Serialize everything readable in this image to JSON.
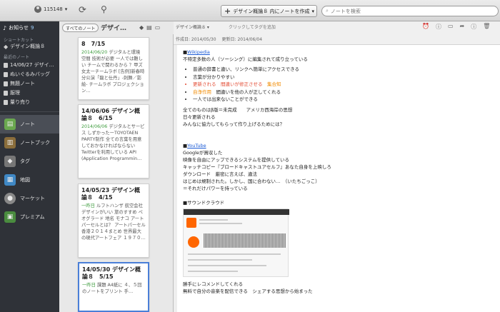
{
  "toolbar": {
    "username": "115148",
    "new_note_label": "デザイン概論８ 内にノートを作成",
    "search_placeholder": "ノートを検索"
  },
  "sidebar": {
    "notice_label": "お知らせ",
    "notice_count": "9",
    "shortcut_heading": "ショートカット",
    "shortcut_items": [
      "デザイン概論８"
    ],
    "recent_heading": "最近のノート",
    "recent_items": [
      "14/06/27 デザイ…",
      "ぬいぐるみバッグ",
      "無題ノート",
      "服理",
      "量り売り"
    ],
    "nav": [
      {
        "label": "ノート",
        "icon": "note-icon",
        "color": "#6aa84f"
      },
      {
        "label": "ノートブック",
        "icon": "notebook-icon",
        "color": "#8a6d3b"
      },
      {
        "label": "タグ",
        "icon": "tag-icon",
        "color": "#777777"
      },
      {
        "label": "地図",
        "icon": "map-icon",
        "color": "#3f88c5"
      },
      {
        "label": "マーケット",
        "icon": "market-icon",
        "color": "#888888"
      },
      {
        "label": "プレミアム",
        "icon": "premium-icon",
        "color": "#4a8c3f"
      }
    ]
  },
  "notelist": {
    "all_notes_label": "すべてのノート",
    "notebook_name": "デザイ…",
    "cards": [
      {
        "title": "8　7/15",
        "date": "2014/06/20",
        "body": "デジタルと環境 空間 技術が必要 一人では難しい チームで関わるから ？甲ズ女太ーチームラボ [告例]新春時分公演「龍と仕丹」-刺舞／影絵- チームラボ プロジェクション…"
      },
      {
        "title": "14/06/06 デザイン概論８　6/15",
        "date": "2014/06/06",
        "body": "デジタルとサービス しずかったーTOYOTAEN PARTY制作 全ての言葉を用意しておかなければならない Twitterを利用している API (Application Programmin…"
      },
      {
        "title": "14/05/23 デザイン概論８　4/15",
        "date": "一昨日",
        "body": "ルフトハンザ 航空会社 デザインがいい 旅のすすめ ペオグラード 地名 モナコ アートパーセルとは？ アートパーセル香港２０１４まとめ 世界最大の現代アートフェア １９７０…"
      },
      {
        "title": "14/05/30 デザイン概論８　5/15",
        "date": "一昨日",
        "body": "課題 A4紙に ４、５回のノートをプリント 手…"
      }
    ]
  },
  "editor": {
    "notebook": "デザイン概論８",
    "tag_placeholder": "クリックしてタグを追加",
    "created": "作成日: 2014/05/30",
    "updated": "更新日: 2014/06/04",
    "sec1_marker": "■",
    "sec1_link": "Wikipedia",
    "sec1_line": "不特定多数の人（ソーシング）に編集されて成り立っている",
    "bullets": [
      {
        "text": "普通の辞書と違い、リンクへ簡単にアクセスできる",
        "extra": ""
      },
      {
        "text": "言葉が分かりやすい",
        "extra": ""
      },
      {
        "text": "更新される　間違いが修正させる　",
        "extra": "集合知"
      },
      {
        "text": "自浄作用",
        "extra": "　間違いを他の人が正してくれる"
      },
      {
        "text": "一人では出来ないことができる",
        "extra": ""
      }
    ],
    "para1": [
      "全てのものはβ版＝未完成　　アメリカ西海岸の思想",
      "日々更新される",
      "みんなに協力してもらって作り上げるためには？"
    ],
    "sec2_marker": "■",
    "sec2_link": "YouTube",
    "para2": [
      "Googleが買収した",
      "映像を自由にアップできるシステムを提供している",
      "キャッチコピー『ブロードキャストユアセルフ』あなた自身を上映しろ",
      "ダウンロード　厳密に言えば、違法",
      "はじめは規制された。しかし、国に合わない…　（いたちごっこ）",
      "＝それだけパワーを持っている"
    ],
    "sec3": "■サウンドクラウド",
    "para3": [
      "勝手にレコメンドしてくれる",
      "無料で自分の音楽を配信できる　シェアする思想から始まった"
    ]
  }
}
